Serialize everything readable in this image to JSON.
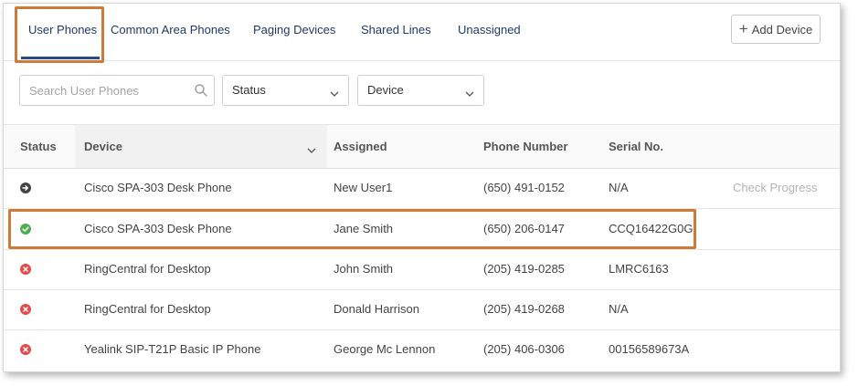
{
  "tabs": [
    {
      "label": "User Phones",
      "active": true
    },
    {
      "label": "Common Area Phones",
      "active": false
    },
    {
      "label": "Paging Devices",
      "active": false
    },
    {
      "label": "Shared Lines",
      "active": false
    },
    {
      "label": "Unassigned",
      "active": false
    }
  ],
  "add_device_label": "Add Device",
  "search": {
    "placeholder": "Search User Phones",
    "value": ""
  },
  "filters": {
    "status_label": "Status",
    "device_label": "Device"
  },
  "table": {
    "headers": {
      "status": "Status",
      "device": "Device",
      "assigned": "Assigned",
      "phone": "Phone Number",
      "serial": "Serial No."
    },
    "rows": [
      {
        "status": "in-progress",
        "device": "Cisco SPA-303 Desk Phone",
        "assigned": "New User1",
        "phone": "(650) 491-0152",
        "serial": "N/A",
        "action": "Check Progress"
      },
      {
        "status": "online",
        "device": "Cisco SPA-303 Desk Phone",
        "assigned": "Jane Smith",
        "phone": "(650) 206-0147",
        "serial": "CCQ16422G0G",
        "action": ""
      },
      {
        "status": "offline",
        "device": "RingCentral for Desktop",
        "assigned": "John Smith",
        "phone": "(205) 419-0285",
        "serial": "LMRC6163",
        "action": ""
      },
      {
        "status": "offline",
        "device": "RingCentral for Desktop",
        "assigned": "Donald Harrison",
        "phone": "(205) 419-0268",
        "serial": "N/A",
        "action": ""
      },
      {
        "status": "offline",
        "device": "Yealink SIP-T21P Basic IP Phone",
        "assigned": "George Mc Lennon",
        "phone": "(205) 406-0306",
        "serial": "00156589673A",
        "action": ""
      }
    ]
  },
  "colors": {
    "accent": "#1f3a68",
    "highlight": "#cc7b3a",
    "status_in_progress": "#444444",
    "status_online": "#4cae4f",
    "status_offline": "#e04b4b"
  },
  "icons": {
    "search": "search-icon",
    "chevron": "chevron-down-icon",
    "add": "plus-icon",
    "status_in_progress": "arrow-right-circle-icon",
    "status_online": "check-circle-icon",
    "status_offline": "x-circle-icon"
  }
}
